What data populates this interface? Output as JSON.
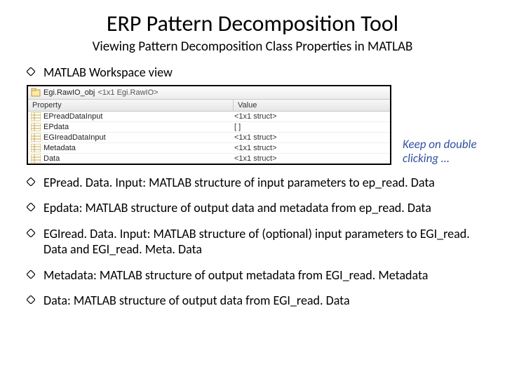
{
  "title": "ERP Pattern Decomposition Tool",
  "subtitle": "Viewing Pattern Decomposition Class Properties in MATLAB",
  "workspace_heading": "MATLAB Workspace view",
  "annotation": "Keep on double clicking …",
  "workspace": {
    "object_label": "Egi.RawIO_obj",
    "object_class": "<1x1 Egi.RawIO>",
    "col_property": "Property",
    "col_value": "Value",
    "rows": [
      {
        "name": "EPreadDataInput",
        "value": "<1x1 struct>"
      },
      {
        "name": "EPdata",
        "value": "[ ]"
      },
      {
        "name": "EGIreadDataInput",
        "value": "<1x1 struct>"
      },
      {
        "name": "Metadata",
        "value": "<1x1 struct>"
      },
      {
        "name": "Data",
        "value": "<1x1 struct>"
      }
    ]
  },
  "definitions": [
    " EPread. Data. Input: MATLAB structure of input parameters to ep_read. Data",
    "Epdata: MATLAB structure of output data and metadata from ep_read. Data",
    "EGIread. Data. Input: MATLAB structure of (optional) input parameters to EGI_read. Data and EGI_read. Meta. Data",
    "Metadata: MATLAB structure of output metadata from EGI_read. Metadata",
    "Data: MATLAB structure of output data from EGI_read. Data"
  ]
}
